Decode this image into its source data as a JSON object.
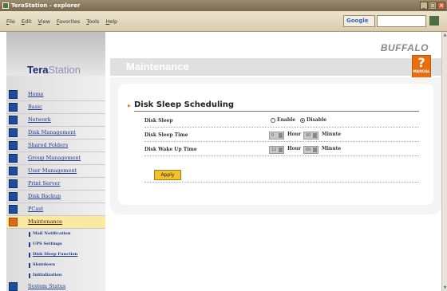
{
  "window": {
    "title": "TeraStation - explorer",
    "menus": [
      "File",
      "Edit",
      "View",
      "Favorites",
      "Tools",
      "Help"
    ],
    "search_label": "Google"
  },
  "header": {
    "logo_tera": "Tera",
    "logo_station": "Station",
    "brand": "BUFFALO",
    "section_title": "Maintenance",
    "manual_label": "MANUAL",
    "manual_glyph": "?"
  },
  "sidebar": {
    "items": [
      {
        "label": "Home",
        "icon": "home-icon"
      },
      {
        "label": "Basic",
        "icon": "basic-icon"
      },
      {
        "label": "Network",
        "icon": "network-icon"
      },
      {
        "label": "Disk Management",
        "icon": "disk-icon"
      },
      {
        "label": "Shared Folders",
        "icon": "folder-icon"
      },
      {
        "label": "Group Management",
        "icon": "group-icon"
      },
      {
        "label": "User Management",
        "icon": "user-icon"
      },
      {
        "label": "Print Server",
        "icon": "printer-icon"
      },
      {
        "label": "Disk Backup",
        "icon": "backup-icon"
      },
      {
        "label": "PCast",
        "icon": "pcast-icon"
      },
      {
        "label": "Maintenance",
        "icon": "maintenance-icon",
        "active": true
      }
    ],
    "sub_items": [
      {
        "label": "Mail Notification"
      },
      {
        "label": "UPS Settings"
      },
      {
        "label": "Disk Sleep Function",
        "current": true
      },
      {
        "label": "Shutdown"
      },
      {
        "label": "Initialization"
      }
    ],
    "bottom_item": {
      "label": "System Status",
      "icon": "status-icon"
    }
  },
  "form": {
    "title": "Disk Sleep Scheduling",
    "disk_sleep": {
      "label": "Disk Sleep",
      "enable": "Enable",
      "disable": "Disable",
      "selected": "Disable"
    },
    "sleep_time": {
      "label": "Disk Sleep Time",
      "hour_value": "0",
      "minute_value": "00",
      "hour_unit": "Hour",
      "minute_unit": "Minute"
    },
    "wake_time": {
      "label": "Disk Wake Up Time",
      "hour_value": "12",
      "minute_value": "00",
      "hour_unit": "Hour",
      "minute_unit": "Minute"
    },
    "apply_label": "Apply"
  },
  "colors": {
    "accent": "#e96e0f",
    "nav_link": "#1f3a8a",
    "apply_button": "#f3c12c"
  }
}
